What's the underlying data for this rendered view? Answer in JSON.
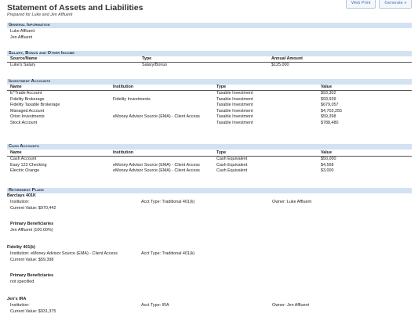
{
  "title": "Statement of Assets and Liabilities",
  "subtitle": "Prepared for Luke and Jen Affluent",
  "buttons": {
    "web_print": "Web Print",
    "generate": "Generate",
    "generate_caret": "▾"
  },
  "general": {
    "heading": "General Information",
    "people": [
      "Luke Affluent",
      "Jen Affluent"
    ]
  },
  "salary": {
    "heading": "Salary, Bonus and Other Income",
    "columns": [
      "Source/Name",
      "Type",
      "Annual Amount"
    ],
    "rows": [
      [
        "Luke's Salary",
        "Salary/Bonus",
        "$125,000"
      ]
    ]
  },
  "investment": {
    "heading": "Investment Accounts",
    "columns": [
      "Name",
      "Institution",
      "Type",
      "Value"
    ],
    "rows": [
      [
        "E*Trade Account",
        "",
        "Taxable Investment",
        "$93,302"
      ],
      [
        "Fidelity Brokerage",
        "Fidelity Investments",
        "Taxable Investment",
        "$93,939"
      ],
      [
        "Fidelity Taxable Brokerage",
        "",
        "Taxable Investment",
        "$679,057"
      ],
      [
        "Managed Account",
        "",
        "Taxable Investment",
        "$4,703,255"
      ],
      [
        "Orion Investments",
        "eMoney Advisor Source (EMA) - Client Access",
        "Taxable Investment",
        "$59,398"
      ],
      [
        "Stock Account",
        "",
        "Taxable Investment",
        "$788,480"
      ]
    ]
  },
  "cash": {
    "heading": "Cash Accounts",
    "columns": [
      "Name",
      "Institution",
      "Type",
      "Value"
    ],
    "rows": [
      [
        "Cash Account",
        "",
        "Cash Equivalent",
        "$50,000"
      ],
      [
        "Easy 123 Checking",
        "eMoney Advisor Source (EMA) - Client Access",
        "Cash Equivalent",
        "$4,568"
      ],
      [
        "Electric Orange",
        "eMoney Advisor Source (EMA) - Client Access",
        "Cash Equivalent",
        "$3,000"
      ]
    ]
  },
  "retirement": {
    "heading": "Retirement Plans",
    "plans": [
      {
        "name": "Barclays 401K",
        "institution": "Institution:",
        "acct_type": "Acct Type: Traditional 401(k)",
        "owner": "Owner: Luke Affluent",
        "current_value": "Current Value: $970,442",
        "beneficiaries_label": "Primary Beneficiaries",
        "beneficiaries": "Jen Affluent (100.00%)"
      },
      {
        "name": "Fidelity 401(k)",
        "institution": "Institution: eMoney Advisor Source (EMA) - Client Access",
        "acct_type": "Acct Type: Traditional 401(k)",
        "owner": "",
        "current_value": "Current Value: $59,398",
        "beneficiaries_label": "Primary Beneficiaries",
        "beneficiaries": "not specified"
      },
      {
        "name": "Jen's IRA",
        "institution": "Institution:",
        "acct_type": "Acct Type: IRA",
        "owner": "Owner: Jen Affluent",
        "current_value": "Current Value: $931,375"
      }
    ]
  }
}
